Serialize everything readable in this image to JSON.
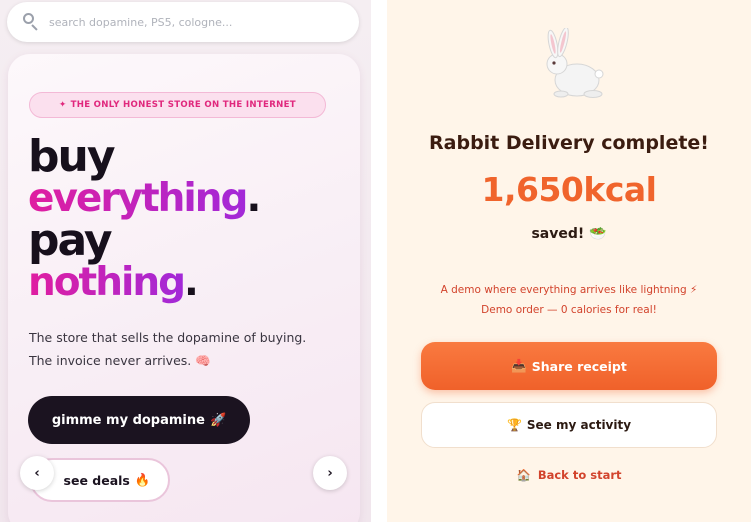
{
  "search": {
    "placeholder": "search dopamine, PS5, cologne..."
  },
  "hero": {
    "badge": "THE ONLY HONEST STORE ON THE INTERNET",
    "line1": "buy",
    "line2": "everything",
    "line3": "pay",
    "line4": "nothing",
    "period": ".",
    "subtitle_line1": "The store that sells the dopamine of buying.",
    "subtitle_line2": "The invoice never arrives.",
    "primary_button": "gimme my dopamine",
    "secondary_button": "see deals",
    "prev_arrow": "‹",
    "next_arrow": "›"
  },
  "delivery": {
    "title": "Rabbit Delivery complete!",
    "kcal": "1,650kcal",
    "saved": "saved!",
    "demo_line1": "A demo where everything arrives like lightning",
    "demo_line2": "Demo order — 0 calories for real!",
    "share_button": "Share receipt",
    "activity_button": "See my activity",
    "back_link": "Back to start"
  },
  "icons": {
    "search": "search-icon",
    "brain": "brain-icon",
    "rocket": "rocket-icon",
    "fire": "fire-icon",
    "rabbit": "rabbit-icon",
    "salad": "salad-icon",
    "lightning": "lightning-icon",
    "inbox": "inbox-tray-icon",
    "trophy": "trophy-icon",
    "house": "house-icon"
  },
  "colors": {
    "brand_pink": "#e0287d",
    "brand_purple": "#a229d8",
    "dark": "#1b1320",
    "orange": "#f0612a",
    "cream": "#fff5e9"
  }
}
